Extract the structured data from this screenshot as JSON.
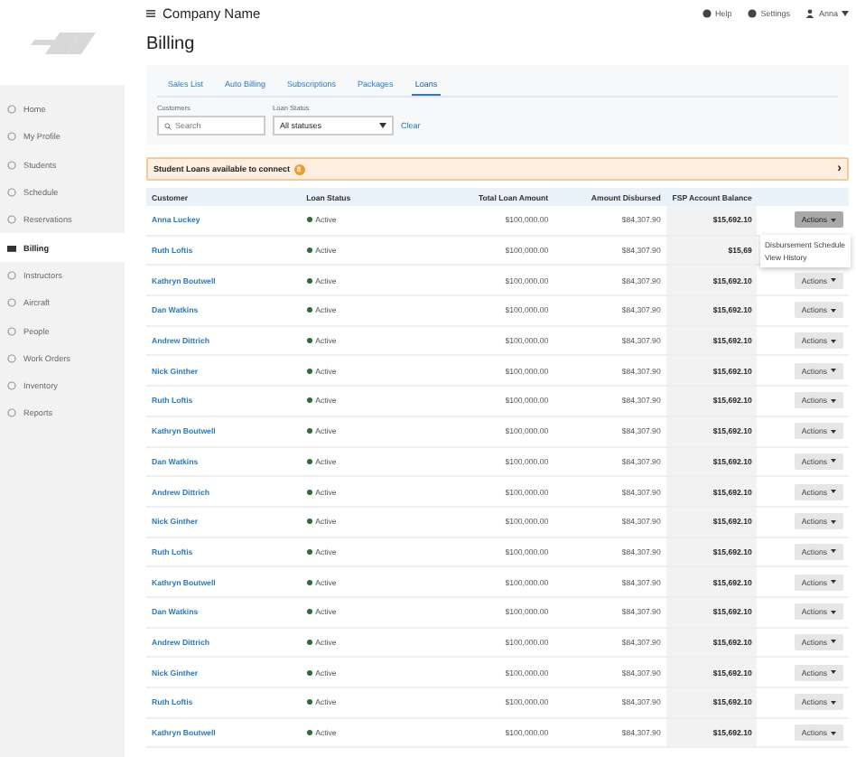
{
  "topbar": {
    "title": "Company Name",
    "links": [
      "Help",
      "Settings"
    ],
    "user": "Anna"
  },
  "sidebar": {
    "items": [
      {
        "label": "Home",
        "selected": false
      },
      {
        "label": "My Profile",
        "selected": false
      },
      {
        "label": "Students",
        "selected": false
      },
      {
        "label": "Schedule",
        "selected": false
      },
      {
        "label": "Reservations",
        "selected": false
      },
      {
        "label": "Billing",
        "selected": true
      },
      {
        "label": "Instructors",
        "selected": false
      },
      {
        "label": "Aircraft",
        "selected": false
      },
      {
        "label": "People",
        "selected": false
      },
      {
        "label": "Work Orders",
        "selected": false
      },
      {
        "label": "Inventory",
        "selected": false
      },
      {
        "label": "Reports",
        "selected": false
      }
    ]
  },
  "page_title": "Billing",
  "tabs": [
    {
      "label": "Sales List",
      "selected": false
    },
    {
      "label": "Auto Billing",
      "selected": false
    },
    {
      "label": "Subscriptions",
      "selected": false
    },
    {
      "label": "Packages",
      "selected": false
    },
    {
      "label": "Loans",
      "selected": true
    }
  ],
  "filters": {
    "customers_label": "Customers",
    "search": {
      "placeholder": "Search"
    },
    "status_label": "Loan Status",
    "status_value": "All statuses",
    "clear": "Clear"
  },
  "banner": {
    "text": "Student Loans available to connect",
    "count": "8",
    "chevron": "›"
  },
  "table": {
    "columns": [
      "Customer",
      "Loan Status",
      "Total Loan Amount",
      "Amount Disbursed",
      "FSP Account Balance"
    ],
    "rows": [
      {
        "customer": "Anna Luckey",
        "status": "Active",
        "total": "$100,000.00",
        "disbursed": "$84,307.90",
        "balance": "$15,692.10",
        "action": "Actions",
        "open": true
      },
      {
        "customer": "Ruth Loftis",
        "status": "Active",
        "total": "$100,000.00",
        "disbursed": "$84,307.90",
        "balance": "$15,69"
      },
      {
        "customer": "Kathryn Boutwell",
        "status": "Active",
        "total": "$100,000.00",
        "disbursed": "$84,307.90",
        "balance": "$15,692.10",
        "action": "Actions",
        "open": false
      },
      {
        "customer": "Dan Watkins",
        "status": "Active",
        "total": "$100,000.00",
        "disbursed": "$84,307.90",
        "balance": "$15,692.10",
        "action": "Actions",
        "open": false
      },
      {
        "customer": "Andrew Dittrich",
        "status": "Active",
        "total": "$100,000.00",
        "disbursed": "$84,307.90",
        "balance": "$15,692.10",
        "action": "Actions",
        "open": false
      },
      {
        "customer": "Nick Ginther",
        "status": "Active",
        "total": "$100,000.00",
        "disbursed": "$84,307.90",
        "balance": "$15,692.10",
        "action": "Actions",
        "open": false
      },
      {
        "customer": "Ruth Loftis",
        "status": "Active",
        "total": "$100,000.00",
        "disbursed": "$84,307.90",
        "balance": "$15,692.10",
        "action": "Actions",
        "open": false
      },
      {
        "customer": "Kathryn Boutwell",
        "status": "Active",
        "total": "$100,000.00",
        "disbursed": "$84,307.90",
        "balance": "$15,692.10",
        "action": "Actions",
        "open": false
      },
      {
        "customer": "Dan Watkins",
        "status": "Active",
        "total": "$100,000.00",
        "disbursed": "$84,307.90",
        "balance": "$15,692.10",
        "action": "Actions",
        "open": false
      },
      {
        "customer": "Andrew Dittrich",
        "status": "Active",
        "total": "$100,000.00",
        "disbursed": "$84,307.90",
        "balance": "$15,692.10",
        "action": "Actions",
        "open": false
      },
      {
        "customer": "Nick Ginther",
        "status": "Active",
        "total": "$100,000.00",
        "disbursed": "$84,307.90",
        "balance": "$15,692.10",
        "action": "Actions",
        "open": false
      },
      {
        "customer": "Ruth Loftis",
        "status": "Active",
        "total": "$100,000.00",
        "disbursed": "$84,307.90",
        "balance": "$15,692.10",
        "action": "Actions",
        "open": false
      },
      {
        "customer": "Kathryn Boutwell",
        "status": "Active",
        "total": "$100,000.00",
        "disbursed": "$84,307.90",
        "balance": "$15,692.10",
        "action": "Actions",
        "open": false
      },
      {
        "customer": "Dan Watkins",
        "status": "Active",
        "total": "$100,000.00",
        "disbursed": "$84,307.90",
        "balance": "$15,692.10",
        "action": "Actions",
        "open": false
      },
      {
        "customer": "Andrew Dittrich",
        "status": "Active",
        "total": "$100,000.00",
        "disbursed": "$84,307.90",
        "balance": "$15,692.10",
        "action": "Actions",
        "open": false
      },
      {
        "customer": "Nick Ginther",
        "status": "Active",
        "total": "$100,000.00",
        "disbursed": "$84,307.90",
        "balance": "$15,692.10",
        "action": "Actions",
        "open": false
      },
      {
        "customer": "Ruth Loftis",
        "status": "Active",
        "total": "$100,000.00",
        "disbursed": "$84,307.90",
        "balance": "$15,692.10",
        "action": "Actions",
        "open": false
      },
      {
        "customer": "Kathryn Boutwell",
        "status": "Active",
        "total": "$100,000.00",
        "disbursed": "$84,307.90",
        "balance": "$15,692.10",
        "action": "Actions",
        "open": false
      }
    ]
  },
  "actions_menu": [
    "Disbursement Schedule",
    "View History"
  ]
}
